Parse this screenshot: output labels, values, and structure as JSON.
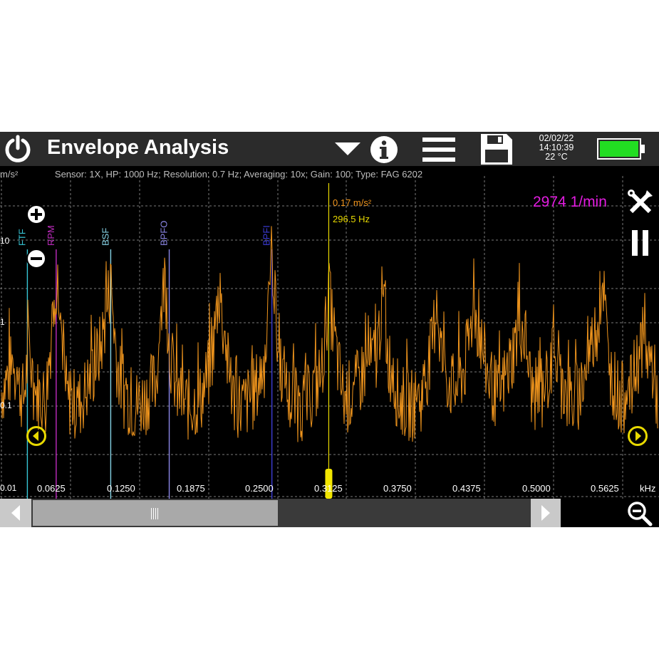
{
  "header": {
    "title": "Envelope Analysis",
    "date": "02/02/22",
    "time": "14:10:39",
    "temperature": "22 °C",
    "battery_color": "#22dd22"
  },
  "info": {
    "unit": "m/s²",
    "text": "Sensor: 1X, HP: 1000 Hz; Resolution: 0.7 Hz; Averaging: 10x; Gain: 100; Type:  FAG 6202"
  },
  "rpm_readout": "2974  1/min",
  "cursor": {
    "amplitude": "0.17 m/s²",
    "frequency": "296.5 Hz",
    "x_khz": 0.2965
  },
  "y_axis": {
    "scale": "log",
    "ticks": [
      "10",
      "1",
      "0.1",
      "0.01"
    ]
  },
  "x_axis": {
    "unit": "kHz",
    "ticks": [
      "0.0625",
      "0.1250",
      "0.1875",
      "0.2500",
      "0.3125",
      "0.3750",
      "0.4375",
      "0.5000",
      "0.5625"
    ]
  },
  "markers": [
    {
      "label": "FTF",
      "x_khz": 0.0235,
      "color": "#37c6d6"
    },
    {
      "label": "RPM",
      "x_khz": 0.0496,
      "color": "#c02cc0"
    },
    {
      "label": "BSF",
      "x_khz": 0.099,
      "color": "#86d3e6"
    },
    {
      "label": "BPFO",
      "x_khz": 0.152,
      "color": "#8b86e6"
    },
    {
      "label": "BPFI",
      "x_khz": 0.245,
      "color": "#3c3cd6"
    }
  ],
  "icons": {
    "power": "power-icon",
    "dropdown": "dropdown-triangle-icon",
    "info": "info-icon",
    "menu": "menu-icon",
    "save": "save-icon",
    "battery": "battery-icon",
    "zoom_in_y": "zoom-in-y-icon",
    "zoom_out_y": "zoom-out-y-icon",
    "tools": "tools-icon",
    "pause": "pause-icon",
    "cursor_left": "cursor-left-icon",
    "cursor_right": "cursor-right-icon",
    "scroll_left": "scroll-left-arrow-icon",
    "scroll_right": "scroll-right-arrow-icon",
    "zoom_out_x": "zoom-out-x-icon"
  },
  "chart_data": {
    "type": "line",
    "xlabel": "kHz",
    "ylabel": "m/s²",
    "scale": "log",
    "xlim": [
      0,
      0.6
    ],
    "ylim": [
      0.01,
      10
    ],
    "series": [
      {
        "color": "#f0951d",
        "x": [
          0,
          0.01,
          0.02,
          0.025,
          0.03,
          0.04,
          0.0496,
          0.055,
          0.06,
          0.07,
          0.08,
          0.09,
          0.099,
          0.105,
          0.11,
          0.12,
          0.13,
          0.14,
          0.148,
          0.152,
          0.16,
          0.17,
          0.18,
          0.19,
          0.197,
          0.205,
          0.21,
          0.22,
          0.23,
          0.24,
          0.245,
          0.25,
          0.26,
          0.27,
          0.28,
          0.29,
          0.2965,
          0.305,
          0.31,
          0.32,
          0.33,
          0.34,
          0.345,
          0.35,
          0.36,
          0.37,
          0.38,
          0.39,
          0.394,
          0.4,
          0.41,
          0.42,
          0.428,
          0.44,
          0.45,
          0.46,
          0.47,
          0.475,
          0.48,
          0.49,
          0.5,
          0.51,
          0.52,
          0.53,
          0.54,
          0.545,
          0.55,
          0.56,
          0.57,
          0.58,
          0.59,
          0.595,
          0.6
        ],
        "values": [
          0.15,
          0.3,
          0.12,
          0.5,
          0.15,
          0.12,
          3.5,
          0.3,
          0.12,
          0.1,
          0.2,
          0.5,
          3.0,
          0.3,
          0.15,
          0.1,
          0.12,
          0.2,
          4.0,
          0.5,
          0.12,
          0.1,
          0.12,
          0.3,
          2.5,
          0.3,
          0.12,
          0.1,
          0.15,
          0.4,
          8.0,
          0.5,
          0.12,
          0.1,
          0.12,
          0.25,
          2.2,
          0.3,
          0.12,
          0.15,
          0.3,
          0.4,
          2.0,
          0.4,
          0.12,
          0.1,
          0.12,
          0.5,
          1.8,
          0.3,
          0.15,
          0.3,
          1.6,
          0.25,
          0.12,
          0.3,
          1.0,
          0.6,
          0.15,
          0.12,
          0.4,
          0.15,
          0.1,
          0.3,
          1.0,
          3.5,
          0.3,
          0.12,
          0.15,
          0.6,
          0.3,
          0.1,
          2.0
        ]
      }
    ]
  }
}
